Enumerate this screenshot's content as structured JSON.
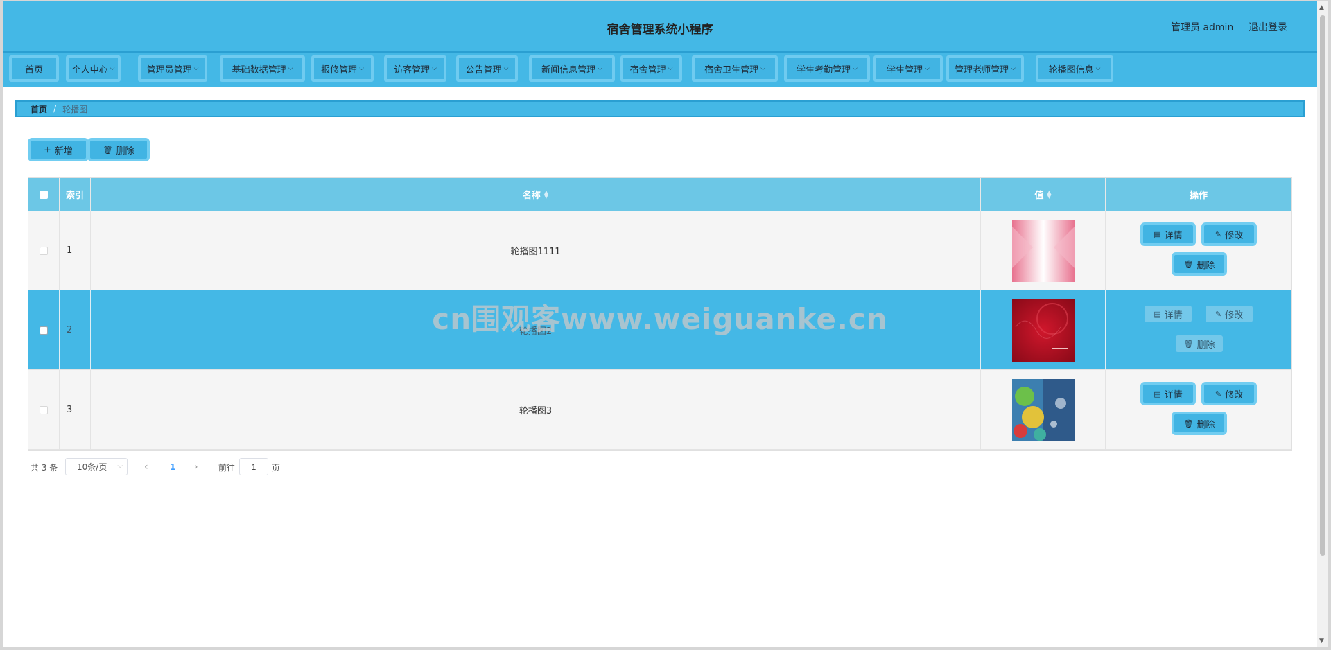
{
  "header": {
    "title": "宿舍管理系统小程序",
    "user": "管理员 admin",
    "logout": "退出登录"
  },
  "nav": [
    {
      "label": "首页",
      "dropdown": false
    },
    {
      "label": "个人中心",
      "dropdown": true
    },
    {
      "label": "管理员管理",
      "dropdown": true
    },
    {
      "label": "基础数据管理",
      "dropdown": true
    },
    {
      "label": "报修管理",
      "dropdown": true
    },
    {
      "label": "访客管理",
      "dropdown": true
    },
    {
      "label": "公告管理",
      "dropdown": true
    },
    {
      "label": "新闻信息管理",
      "dropdown": true
    },
    {
      "label": "宿舍管理",
      "dropdown": true
    },
    {
      "label": "宿舍卫生管理",
      "dropdown": true
    },
    {
      "label": "学生考勤管理",
      "dropdown": true
    },
    {
      "label": "学生管理",
      "dropdown": true
    },
    {
      "label": "管理老师管理",
      "dropdown": true
    },
    {
      "label": "轮播图信息",
      "dropdown": true
    }
  ],
  "breadcrumb": {
    "home": "首页",
    "separator": "/",
    "current": "轮播图"
  },
  "toolbar": {
    "add": "新增",
    "delete": "删除"
  },
  "table": {
    "columns": {
      "index": "索引",
      "name": "名称",
      "value": "值",
      "actions": "操作"
    },
    "rows": [
      {
        "index": "1",
        "name": "轮播图1111",
        "thumb": "pink-banner-thumbnail"
      },
      {
        "index": "2",
        "name": "轮播图2",
        "thumb": "red-banner-thumbnail"
      },
      {
        "index": "3",
        "name": "轮播图3",
        "thumb": "colorful-banner-thumbnail"
      }
    ],
    "actions": {
      "detail": "详情",
      "edit": "修改",
      "delete": "删除"
    }
  },
  "pagination": {
    "total": "共 3 条",
    "page_size": "10条/页",
    "current_page": "1",
    "goto_label": "前往",
    "goto_value": "1",
    "page_suffix": "页"
  },
  "watermark": "cn围观客www.weiguanke.cn",
  "colors": {
    "primary": "#44b8e6",
    "button_border": "#71cdf1",
    "header_bg": "#6cc7e6",
    "active_page": "#409eff"
  }
}
